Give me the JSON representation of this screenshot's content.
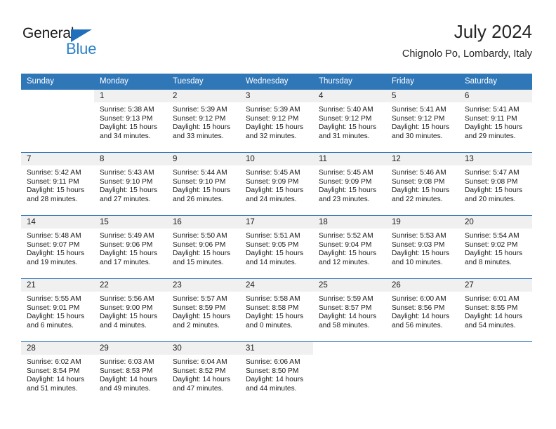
{
  "brand": {
    "word_general": "General",
    "word_blue": "Blue",
    "accent_blue": "#2a81c8",
    "triangle_blue": "#1f6fba"
  },
  "header": {
    "title": "July 2024",
    "subtitle": "Chignolo Po, Lombardy, Italy",
    "header_bg": "#3077b8",
    "daynum_band_bg": "#f0f0f0"
  },
  "weekday_headers": [
    "Sunday",
    "Monday",
    "Tuesday",
    "Wednesday",
    "Thursday",
    "Friday",
    "Saturday"
  ],
  "weeks": [
    [
      {
        "day": "",
        "sunrise": "",
        "sunset": "",
        "daylight_line1": "",
        "daylight_line2": ""
      },
      {
        "day": "1",
        "sunrise": "Sunrise: 5:38 AM",
        "sunset": "Sunset: 9:13 PM",
        "daylight_line1": "Daylight: 15 hours",
        "daylight_line2": "and 34 minutes."
      },
      {
        "day": "2",
        "sunrise": "Sunrise: 5:39 AM",
        "sunset": "Sunset: 9:12 PM",
        "daylight_line1": "Daylight: 15 hours",
        "daylight_line2": "and 33 minutes."
      },
      {
        "day": "3",
        "sunrise": "Sunrise: 5:39 AM",
        "sunset": "Sunset: 9:12 PM",
        "daylight_line1": "Daylight: 15 hours",
        "daylight_line2": "and 32 minutes."
      },
      {
        "day": "4",
        "sunrise": "Sunrise: 5:40 AM",
        "sunset": "Sunset: 9:12 PM",
        "daylight_line1": "Daylight: 15 hours",
        "daylight_line2": "and 31 minutes."
      },
      {
        "day": "5",
        "sunrise": "Sunrise: 5:41 AM",
        "sunset": "Sunset: 9:12 PM",
        "daylight_line1": "Daylight: 15 hours",
        "daylight_line2": "and 30 minutes."
      },
      {
        "day": "6",
        "sunrise": "Sunrise: 5:41 AM",
        "sunset": "Sunset: 9:11 PM",
        "daylight_line1": "Daylight: 15 hours",
        "daylight_line2": "and 29 minutes."
      }
    ],
    [
      {
        "day": "7",
        "sunrise": "Sunrise: 5:42 AM",
        "sunset": "Sunset: 9:11 PM",
        "daylight_line1": "Daylight: 15 hours",
        "daylight_line2": "and 28 minutes."
      },
      {
        "day": "8",
        "sunrise": "Sunrise: 5:43 AM",
        "sunset": "Sunset: 9:10 PM",
        "daylight_line1": "Daylight: 15 hours",
        "daylight_line2": "and 27 minutes."
      },
      {
        "day": "9",
        "sunrise": "Sunrise: 5:44 AM",
        "sunset": "Sunset: 9:10 PM",
        "daylight_line1": "Daylight: 15 hours",
        "daylight_line2": "and 26 minutes."
      },
      {
        "day": "10",
        "sunrise": "Sunrise: 5:45 AM",
        "sunset": "Sunset: 9:09 PM",
        "daylight_line1": "Daylight: 15 hours",
        "daylight_line2": "and 24 minutes."
      },
      {
        "day": "11",
        "sunrise": "Sunrise: 5:45 AM",
        "sunset": "Sunset: 9:09 PM",
        "daylight_line1": "Daylight: 15 hours",
        "daylight_line2": "and 23 minutes."
      },
      {
        "day": "12",
        "sunrise": "Sunrise: 5:46 AM",
        "sunset": "Sunset: 9:08 PM",
        "daylight_line1": "Daylight: 15 hours",
        "daylight_line2": "and 22 minutes."
      },
      {
        "day": "13",
        "sunrise": "Sunrise: 5:47 AM",
        "sunset": "Sunset: 9:08 PM",
        "daylight_line1": "Daylight: 15 hours",
        "daylight_line2": "and 20 minutes."
      }
    ],
    [
      {
        "day": "14",
        "sunrise": "Sunrise: 5:48 AM",
        "sunset": "Sunset: 9:07 PM",
        "daylight_line1": "Daylight: 15 hours",
        "daylight_line2": "and 19 minutes."
      },
      {
        "day": "15",
        "sunrise": "Sunrise: 5:49 AM",
        "sunset": "Sunset: 9:06 PM",
        "daylight_line1": "Daylight: 15 hours",
        "daylight_line2": "and 17 minutes."
      },
      {
        "day": "16",
        "sunrise": "Sunrise: 5:50 AM",
        "sunset": "Sunset: 9:06 PM",
        "daylight_line1": "Daylight: 15 hours",
        "daylight_line2": "and 15 minutes."
      },
      {
        "day": "17",
        "sunrise": "Sunrise: 5:51 AM",
        "sunset": "Sunset: 9:05 PM",
        "daylight_line1": "Daylight: 15 hours",
        "daylight_line2": "and 14 minutes."
      },
      {
        "day": "18",
        "sunrise": "Sunrise: 5:52 AM",
        "sunset": "Sunset: 9:04 PM",
        "daylight_line1": "Daylight: 15 hours",
        "daylight_line2": "and 12 minutes."
      },
      {
        "day": "19",
        "sunrise": "Sunrise: 5:53 AM",
        "sunset": "Sunset: 9:03 PM",
        "daylight_line1": "Daylight: 15 hours",
        "daylight_line2": "and 10 minutes."
      },
      {
        "day": "20",
        "sunrise": "Sunrise: 5:54 AM",
        "sunset": "Sunset: 9:02 PM",
        "daylight_line1": "Daylight: 15 hours",
        "daylight_line2": "and 8 minutes."
      }
    ],
    [
      {
        "day": "21",
        "sunrise": "Sunrise: 5:55 AM",
        "sunset": "Sunset: 9:01 PM",
        "daylight_line1": "Daylight: 15 hours",
        "daylight_line2": "and 6 minutes."
      },
      {
        "day": "22",
        "sunrise": "Sunrise: 5:56 AM",
        "sunset": "Sunset: 9:00 PM",
        "daylight_line1": "Daylight: 15 hours",
        "daylight_line2": "and 4 minutes."
      },
      {
        "day": "23",
        "sunrise": "Sunrise: 5:57 AM",
        "sunset": "Sunset: 8:59 PM",
        "daylight_line1": "Daylight: 15 hours",
        "daylight_line2": "and 2 minutes."
      },
      {
        "day": "24",
        "sunrise": "Sunrise: 5:58 AM",
        "sunset": "Sunset: 8:58 PM",
        "daylight_line1": "Daylight: 15 hours",
        "daylight_line2": "and 0 minutes."
      },
      {
        "day": "25",
        "sunrise": "Sunrise: 5:59 AM",
        "sunset": "Sunset: 8:57 PM",
        "daylight_line1": "Daylight: 14 hours",
        "daylight_line2": "and 58 minutes."
      },
      {
        "day": "26",
        "sunrise": "Sunrise: 6:00 AM",
        "sunset": "Sunset: 8:56 PM",
        "daylight_line1": "Daylight: 14 hours",
        "daylight_line2": "and 56 minutes."
      },
      {
        "day": "27",
        "sunrise": "Sunrise: 6:01 AM",
        "sunset": "Sunset: 8:55 PM",
        "daylight_line1": "Daylight: 14 hours",
        "daylight_line2": "and 54 minutes."
      }
    ],
    [
      {
        "day": "28",
        "sunrise": "Sunrise: 6:02 AM",
        "sunset": "Sunset: 8:54 PM",
        "daylight_line1": "Daylight: 14 hours",
        "daylight_line2": "and 51 minutes."
      },
      {
        "day": "29",
        "sunrise": "Sunrise: 6:03 AM",
        "sunset": "Sunset: 8:53 PM",
        "daylight_line1": "Daylight: 14 hours",
        "daylight_line2": "and 49 minutes."
      },
      {
        "day": "30",
        "sunrise": "Sunrise: 6:04 AM",
        "sunset": "Sunset: 8:52 PM",
        "daylight_line1": "Daylight: 14 hours",
        "daylight_line2": "and 47 minutes."
      },
      {
        "day": "31",
        "sunrise": "Sunrise: 6:06 AM",
        "sunset": "Sunset: 8:50 PM",
        "daylight_line1": "Daylight: 14 hours",
        "daylight_line2": "and 44 minutes."
      },
      {
        "day": "",
        "sunrise": "",
        "sunset": "",
        "daylight_line1": "",
        "daylight_line2": ""
      },
      {
        "day": "",
        "sunrise": "",
        "sunset": "",
        "daylight_line1": "",
        "daylight_line2": ""
      },
      {
        "day": "",
        "sunrise": "",
        "sunset": "",
        "daylight_line1": "",
        "daylight_line2": ""
      }
    ]
  ]
}
